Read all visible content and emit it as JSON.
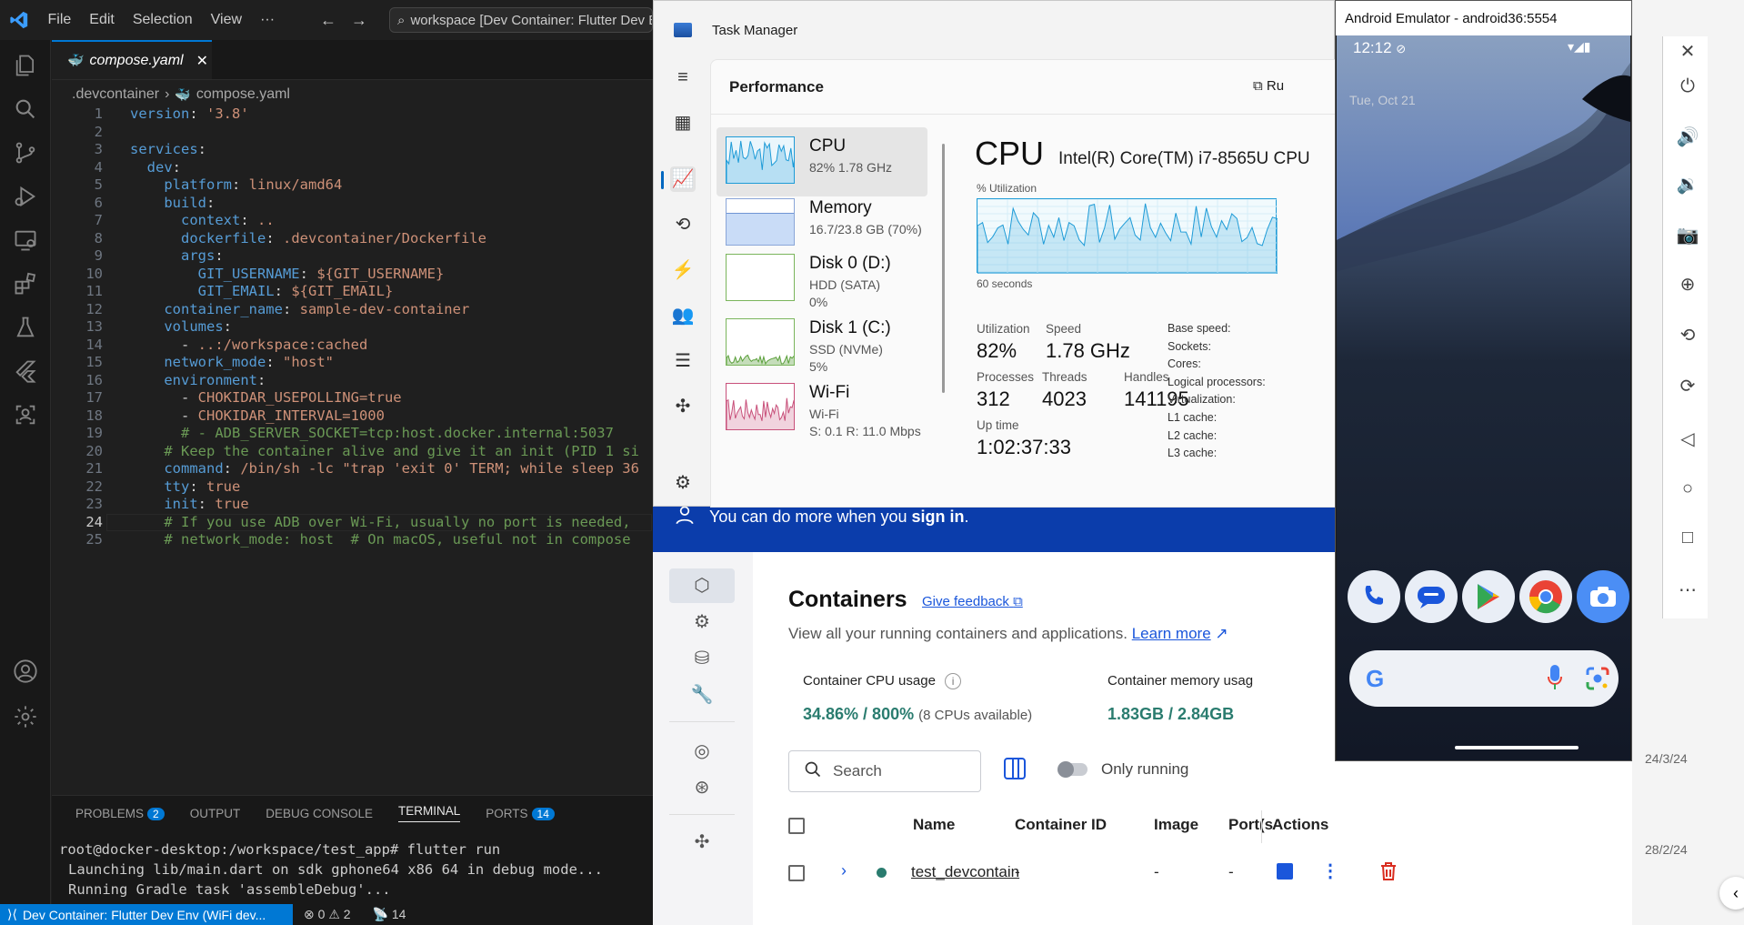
{
  "vscode": {
    "menus": [
      "File",
      "Edit",
      "Selection",
      "View",
      "···"
    ],
    "search_text": "workspace [Dev Container: Flutter Dev Env (WiFi dev...",
    "tab_label": "compose.yaml",
    "breadcrumb": [
      ".devcontainer",
      "compose.yaml"
    ],
    "current_line": 24,
    "code_lines": [
      "version: '3.8'",
      "",
      "services:",
      "  dev:",
      "    platform: linux/amd64",
      "    build:",
      "      context: ..",
      "      dockerfile: .devcontainer/Dockerfile",
      "      args:",
      "        GIT_USERNAME: ${GIT_USERNAME}",
      "        GIT_EMAIL: ${GIT_EMAIL}",
      "    container_name: sample-dev-container",
      "    volumes:",
      "      - ..:/workspace:cached",
      "    network_mode: \"host\"",
      "    environment:",
      "      - CHOKIDAR_USEPOLLING=true",
      "      - CHOKIDAR_INTERVAL=1000",
      "      # - ADB_SERVER_SOCKET=tcp:host.docker.internal:5037",
      "    # Keep the container alive and give it an init (PID 1 si",
      "    command: /bin/sh -lc \"trap 'exit 0' TERM; while sleep 36",
      "    tty: true",
      "    init: true",
      "    # If you use ADB over Wi-Fi, usually no port is needed,",
      "    # network_mode: host  # On macOS, useful not in compose"
    ],
    "panel": {
      "tabs": [
        "PROBLEMS",
        "OUTPUT",
        "DEBUG CONSOLE",
        "TERMINAL",
        "PORTS"
      ],
      "problems_count": "2",
      "ports_count": "14",
      "active": "TERMINAL",
      "terminal_lines": [
        "root@docker-desktop:/workspace/test_app# flutter run",
        "Launching lib/main.dart on sdk gphone64 x86 64 in debug mode...",
        "Running Gradle task 'assembleDebug'..."
      ]
    },
    "status": {
      "remote": "Dev Container: Flutter Dev Env (WiFi dev...",
      "errors": "0",
      "warnings": "2",
      "ports": "14"
    }
  },
  "task_manager": {
    "title": "Task Manager",
    "section": "Performance",
    "run_label": "Ru",
    "items": [
      {
        "name": "CPU",
        "d1": "82%  1.78 GHz",
        "d2": ""
      },
      {
        "name": "Memory",
        "d1": "16.7/23.8 GB (70%)",
        "d2": ""
      },
      {
        "name": "Disk 0 (D:)",
        "d1": "HDD (SATA)",
        "d2": "0%"
      },
      {
        "name": "Disk 1 (C:)",
        "d1": "SSD (NVMe)",
        "d2": "5%"
      },
      {
        "name": "Wi-Fi",
        "d1": "Wi-Fi",
        "d2": "S: 0.1  R: 11.0 Mbps"
      }
    ],
    "detail": {
      "heading": "CPU",
      "processor": "Intel(R) Core(TM) i7-8565U CPU",
      "util_label": "% Utilization",
      "seconds_label": "60 seconds",
      "utilization_label": "Utilization",
      "utilization": "82%",
      "speed_label": "Speed",
      "speed": "1.78 GHz",
      "processes_label": "Processes",
      "processes": "312",
      "threads_label": "Threads",
      "threads": "4023",
      "handles_label": "Handles",
      "handles": "141195",
      "uptime_label": "Up time",
      "uptime": "1:02:37:33",
      "right_labels": [
        "Base speed:",
        "Sockets:",
        "Cores:",
        "Logical processors:",
        "Virtualization:",
        "L1 cache:",
        "L2 cache:",
        "L3 cache:"
      ]
    }
  },
  "docker": {
    "banner_text": "You can do more when you ",
    "banner_link": "sign in",
    "title": "Containers",
    "feedback": "Give feedback",
    "subtitle": "View all your running containers and applications.",
    "learn_more": "Learn more",
    "cpu_label": "Container CPU usage",
    "cpu_value": "34.86% / 800%",
    "cpu_note": "(8 CPUs available)",
    "mem_label": "Container memory usag",
    "mem_value": "1.83GB / 2.84GB",
    "search_placeholder": "Search",
    "only_running": "Only running",
    "columns": [
      "Name",
      "Container ID",
      "Image",
      "Port(s",
      "Actions"
    ],
    "row": {
      "name": "test_devcontain",
      "id": "-",
      "image": "-",
      "ports": "-"
    }
  },
  "emulator": {
    "title": "Android Emulator - android36:5554",
    "time": "12:12",
    "date": "Tue, Oct 21",
    "apps": [
      "phone-app",
      "messages-app",
      "play-store-app",
      "chrome-app",
      "camera-app"
    ]
  },
  "background_dates": [
    "24/3/24",
    "28/2/24"
  ]
}
